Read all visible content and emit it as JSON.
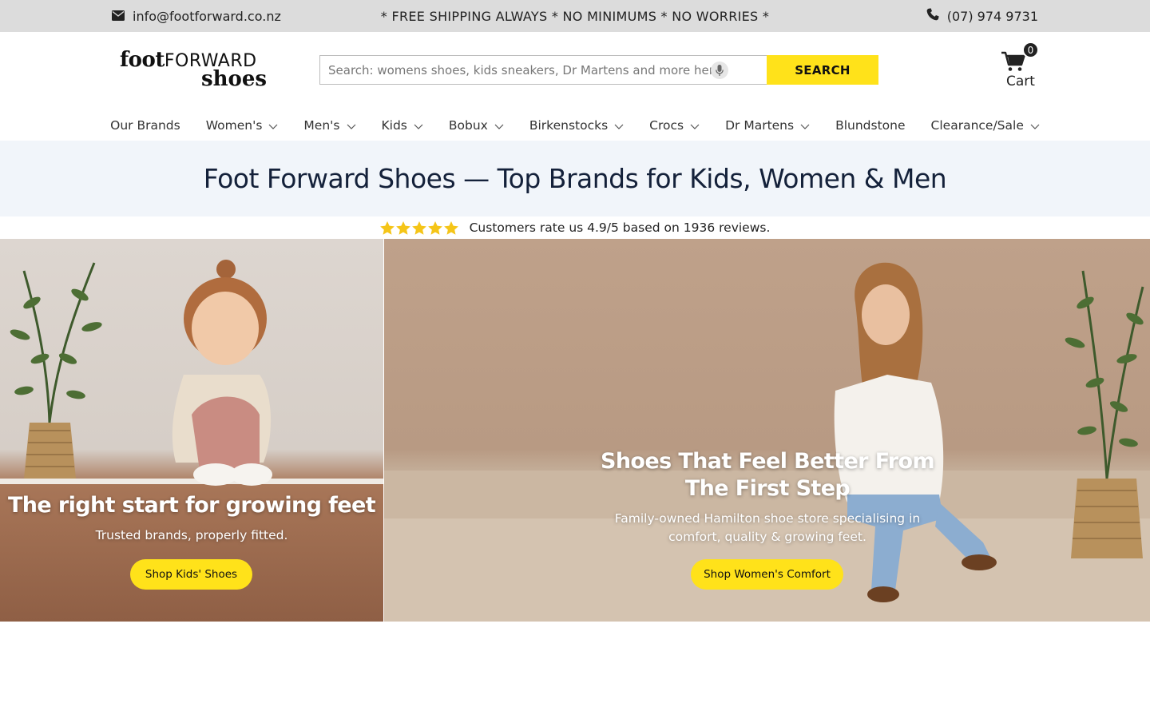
{
  "topbar": {
    "email": "info@footforward.co.nz",
    "promo": "* FREE SHIPPING ALWAYS * NO MINIMUMS * NO WORRIES *",
    "phone": "(07) 974 9731"
  },
  "logo": {
    "line1_bold": "foot",
    "line1_thin": "FORWARD",
    "line2": "shoes"
  },
  "search": {
    "placeholder": "Search: womens shoes, kids sneakers, Dr Martens and more here",
    "button_label": "SEARCH"
  },
  "cart": {
    "count": "0",
    "label": "Cart"
  },
  "nav": {
    "items": [
      {
        "label": "Our Brands",
        "has_dropdown": false
      },
      {
        "label": "Women's",
        "has_dropdown": true
      },
      {
        "label": "Men's",
        "has_dropdown": true
      },
      {
        "label": "Kids",
        "has_dropdown": true
      },
      {
        "label": "Bobux",
        "has_dropdown": true
      },
      {
        "label": "Birkenstocks",
        "has_dropdown": true
      },
      {
        "label": "Crocs",
        "has_dropdown": true
      },
      {
        "label": "Dr Martens",
        "has_dropdown": true
      },
      {
        "label": "Blundstone",
        "has_dropdown": false
      },
      {
        "label": "Clearance/Sale",
        "has_dropdown": true
      }
    ]
  },
  "heading": "Foot Forward Shoes — Top Brands for Kids, Women & Men",
  "rating": {
    "stars": 5,
    "text": "Customers rate us 4.9/5 based on 1936 reviews."
  },
  "hero_left": {
    "title": "The right start for growing feet",
    "subtitle": "Trusted brands, properly fitted.",
    "button": "Shop Kids' Shoes"
  },
  "hero_right": {
    "title": "Shoes That Feel Better From The First Step",
    "subtitle": "Family-owned Hamilton shoe store specialising in comfort, quality & growing feet.",
    "button": "Shop Women's Comfort"
  },
  "colors": {
    "accent_yellow": "#ffe21a",
    "topbar_bg": "#dcdcdc",
    "heading_band_bg": "#f1f5fa",
    "heading_text": "#14213a",
    "star": "#f5c518"
  }
}
